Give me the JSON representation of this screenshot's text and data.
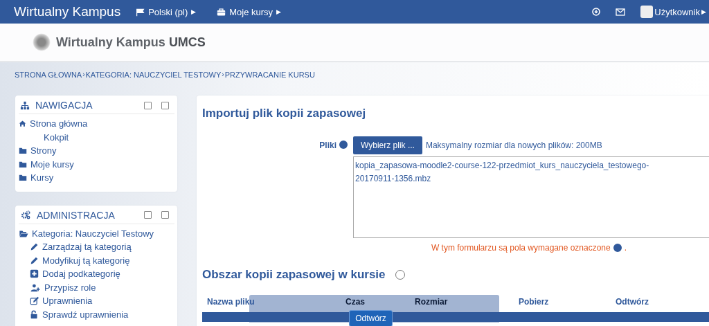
{
  "navbar": {
    "brand": "Wirtualny Kampus",
    "menus": [
      {
        "label": "Polski (pl)",
        "kind": "flag",
        "caret": "▶"
      },
      {
        "label": "Moje kursy",
        "kind": "briefcase",
        "caret": "▶"
      }
    ],
    "user": "Użytkownik",
    "user_caret": "▶"
  },
  "header": {
    "logo_text": "Wirtualny Kampus ",
    "logo_bold": "UMCS"
  },
  "breadcrumb": [
    {
      "label": "STRONA GŁOWNA",
      "separator": "›"
    },
    {
      "label": "KATEGORIA: NAUCZYCIEL TESTOWY",
      "separator": "›"
    },
    {
      "label": "PRZYWRACANIE KURSU"
    }
  ],
  "blocks": [
    {
      "title": "NAWIGACJA",
      "kind": "sitemap",
      "items": [
        {
          "label": "Strona główna",
          "kind": "home",
          "children": [
            {
              "label": "Kokpit"
            }
          ]
        },
        {
          "label": "Strony",
          "kind": "folder"
        },
        {
          "label": "Moje kursy",
          "kind": "folder"
        },
        {
          "label": "Kursy",
          "kind": "folder"
        }
      ]
    },
    {
      "title": "ADMINISTRACJA",
      "kind": "gears",
      "items": [
        {
          "label": "Kategoria: Nauczyciel Testowy",
          "kind": "folder-open",
          "children": [
            {
              "label": "Zarządzaj tą kategorią",
              "kind": "pencil"
            },
            {
              "label": "Modyfikuj tą kategorię",
              "kind": "pencil"
            },
            {
              "label": "Dodaj podkategorię",
              "kind": "plus"
            },
            {
              "label": "Przypisz role",
              "kind": "user-plus"
            },
            {
              "label": "Uprawnienia",
              "kind": "edit"
            },
            {
              "label": "Sprawdź uprawnienia",
              "kind": "lock"
            }
          ]
        }
      ]
    }
  ],
  "import": {
    "title": "Importuj plik kopii zapasowej",
    "field_label": "Pliki",
    "button": "Wybierz plik ...",
    "max_size": "Maksymalny rozmiar dla nowych plików: 200MB",
    "file": "kopia_zapasowa-moodle2-course-122-przedmiot_kurs_nauczyciela_testowego-20170911-1356.mbz",
    "required_note": "W tym formularzu są pola wymagane oznaczone",
    "required_note_end": "."
  },
  "backup_area": {
    "title": "Obszar kopii zapasowej w kursie",
    "columns": [
      "Nazwa pliku",
      "Czas",
      "Rozmiar",
      "Pobierz",
      "Odtwórz"
    ]
  },
  "overlay": {
    "button": "Odtwórz"
  }
}
